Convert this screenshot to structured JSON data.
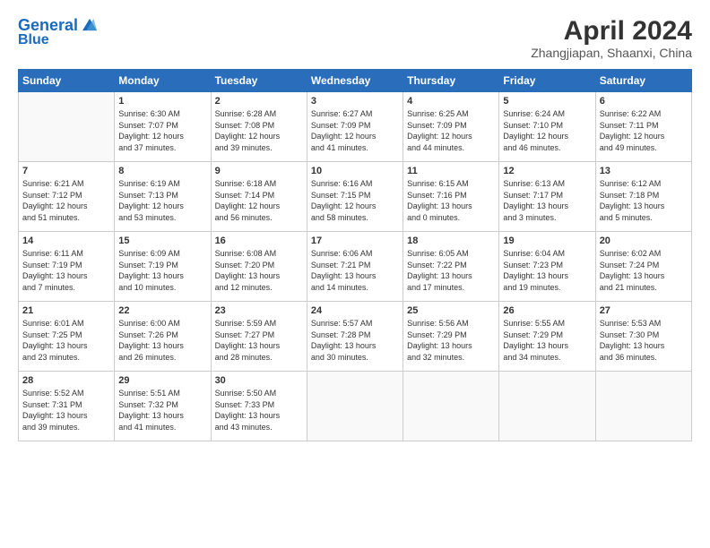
{
  "header": {
    "logo_line1": "General",
    "logo_line2": "Blue",
    "month": "April 2024",
    "location": "Zhangjiapan, Shaanxi, China"
  },
  "weekdays": [
    "Sunday",
    "Monday",
    "Tuesday",
    "Wednesday",
    "Thursday",
    "Friday",
    "Saturday"
  ],
  "weeks": [
    [
      {
        "day": "",
        "info": ""
      },
      {
        "day": "1",
        "info": "Sunrise: 6:30 AM\nSunset: 7:07 PM\nDaylight: 12 hours\nand 37 minutes."
      },
      {
        "day": "2",
        "info": "Sunrise: 6:28 AM\nSunset: 7:08 PM\nDaylight: 12 hours\nand 39 minutes."
      },
      {
        "day": "3",
        "info": "Sunrise: 6:27 AM\nSunset: 7:09 PM\nDaylight: 12 hours\nand 41 minutes."
      },
      {
        "day": "4",
        "info": "Sunrise: 6:25 AM\nSunset: 7:09 PM\nDaylight: 12 hours\nand 44 minutes."
      },
      {
        "day": "5",
        "info": "Sunrise: 6:24 AM\nSunset: 7:10 PM\nDaylight: 12 hours\nand 46 minutes."
      },
      {
        "day": "6",
        "info": "Sunrise: 6:22 AM\nSunset: 7:11 PM\nDaylight: 12 hours\nand 49 minutes."
      }
    ],
    [
      {
        "day": "7",
        "info": "Sunrise: 6:21 AM\nSunset: 7:12 PM\nDaylight: 12 hours\nand 51 minutes."
      },
      {
        "day": "8",
        "info": "Sunrise: 6:19 AM\nSunset: 7:13 PM\nDaylight: 12 hours\nand 53 minutes."
      },
      {
        "day": "9",
        "info": "Sunrise: 6:18 AM\nSunset: 7:14 PM\nDaylight: 12 hours\nand 56 minutes."
      },
      {
        "day": "10",
        "info": "Sunrise: 6:16 AM\nSunset: 7:15 PM\nDaylight: 12 hours\nand 58 minutes."
      },
      {
        "day": "11",
        "info": "Sunrise: 6:15 AM\nSunset: 7:16 PM\nDaylight: 13 hours\nand 0 minutes."
      },
      {
        "day": "12",
        "info": "Sunrise: 6:13 AM\nSunset: 7:17 PM\nDaylight: 13 hours\nand 3 minutes."
      },
      {
        "day": "13",
        "info": "Sunrise: 6:12 AM\nSunset: 7:18 PM\nDaylight: 13 hours\nand 5 minutes."
      }
    ],
    [
      {
        "day": "14",
        "info": "Sunrise: 6:11 AM\nSunset: 7:19 PM\nDaylight: 13 hours\nand 7 minutes."
      },
      {
        "day": "15",
        "info": "Sunrise: 6:09 AM\nSunset: 7:19 PM\nDaylight: 13 hours\nand 10 minutes."
      },
      {
        "day": "16",
        "info": "Sunrise: 6:08 AM\nSunset: 7:20 PM\nDaylight: 13 hours\nand 12 minutes."
      },
      {
        "day": "17",
        "info": "Sunrise: 6:06 AM\nSunset: 7:21 PM\nDaylight: 13 hours\nand 14 minutes."
      },
      {
        "day": "18",
        "info": "Sunrise: 6:05 AM\nSunset: 7:22 PM\nDaylight: 13 hours\nand 17 minutes."
      },
      {
        "day": "19",
        "info": "Sunrise: 6:04 AM\nSunset: 7:23 PM\nDaylight: 13 hours\nand 19 minutes."
      },
      {
        "day": "20",
        "info": "Sunrise: 6:02 AM\nSunset: 7:24 PM\nDaylight: 13 hours\nand 21 minutes."
      }
    ],
    [
      {
        "day": "21",
        "info": "Sunrise: 6:01 AM\nSunset: 7:25 PM\nDaylight: 13 hours\nand 23 minutes."
      },
      {
        "day": "22",
        "info": "Sunrise: 6:00 AM\nSunset: 7:26 PM\nDaylight: 13 hours\nand 26 minutes."
      },
      {
        "day": "23",
        "info": "Sunrise: 5:59 AM\nSunset: 7:27 PM\nDaylight: 13 hours\nand 28 minutes."
      },
      {
        "day": "24",
        "info": "Sunrise: 5:57 AM\nSunset: 7:28 PM\nDaylight: 13 hours\nand 30 minutes."
      },
      {
        "day": "25",
        "info": "Sunrise: 5:56 AM\nSunset: 7:29 PM\nDaylight: 13 hours\nand 32 minutes."
      },
      {
        "day": "26",
        "info": "Sunrise: 5:55 AM\nSunset: 7:29 PM\nDaylight: 13 hours\nand 34 minutes."
      },
      {
        "day": "27",
        "info": "Sunrise: 5:53 AM\nSunset: 7:30 PM\nDaylight: 13 hours\nand 36 minutes."
      }
    ],
    [
      {
        "day": "28",
        "info": "Sunrise: 5:52 AM\nSunset: 7:31 PM\nDaylight: 13 hours\nand 39 minutes."
      },
      {
        "day": "29",
        "info": "Sunrise: 5:51 AM\nSunset: 7:32 PM\nDaylight: 13 hours\nand 41 minutes."
      },
      {
        "day": "30",
        "info": "Sunrise: 5:50 AM\nSunset: 7:33 PM\nDaylight: 13 hours\nand 43 minutes."
      },
      {
        "day": "",
        "info": ""
      },
      {
        "day": "",
        "info": ""
      },
      {
        "day": "",
        "info": ""
      },
      {
        "day": "",
        "info": ""
      }
    ]
  ]
}
